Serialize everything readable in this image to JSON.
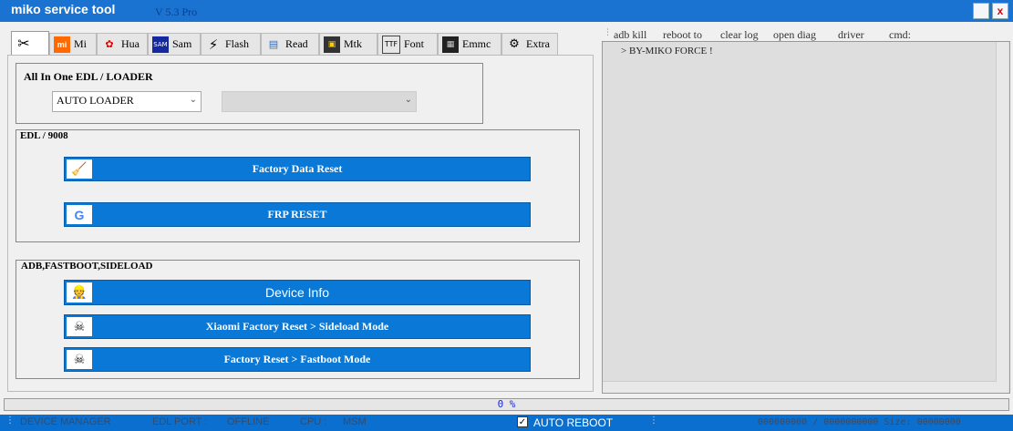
{
  "window": {
    "title": "miko service tool",
    "version": "V 5.3 Pro",
    "close_glyph": "x"
  },
  "tabs": [
    {
      "label": "",
      "icon": "tools-icon"
    },
    {
      "label": "Mi",
      "icon": "mi-logo-icon"
    },
    {
      "label": "Hua",
      "icon": "huawei-logo-icon"
    },
    {
      "label": "Sam",
      "icon": "samsung-logo-icon"
    },
    {
      "label": "Flash",
      "icon": "lightning-icon"
    },
    {
      "label": "Read",
      "icon": "database-icon"
    },
    {
      "label": "Mtk",
      "icon": "chip-icon"
    },
    {
      "label": "Font",
      "icon": "font-file-icon"
    },
    {
      "label": "Emmc",
      "icon": "emmc-chip-icon"
    },
    {
      "label": "Extra",
      "icon": "extra-icon"
    }
  ],
  "edl_loader": {
    "label": "All In One  EDL / LOADER",
    "loader_select": "AUTO LOADER",
    "second_select": ""
  },
  "edl_group": {
    "label": "EDL / 9008",
    "buttons": [
      {
        "label": "Factory Data Reset",
        "icon": "broom-icon"
      },
      {
        "label": "FRP RESET",
        "icon": "google-icon"
      }
    ]
  },
  "adb_group": {
    "label": "ADB,FASTBOOT,SIDELOAD",
    "buttons": [
      {
        "label": "Device Info",
        "icon": "technician-icon"
      },
      {
        "label": "Xiaomi Factory Reset > Sideload Mode",
        "icon": "skull-icon"
      },
      {
        "label": "Factory Reset > Fastboot Mode",
        "icon": "skull-icon"
      }
    ]
  },
  "right_menu": [
    "adb kill",
    "reboot to",
    "clear log",
    "open diag",
    "driver",
    "cmd:"
  ],
  "log": {
    "line1": "> BY-MIKO FORCE !"
  },
  "progress": {
    "text": "0  %",
    "value": 0
  },
  "status": {
    "device_manager": "DEVICE MANAGER",
    "edl_port": "EDL PORT :",
    "offline": "OFFLINE",
    "cpu": "CPU :",
    "msm": "MSM",
    "auto_reboot": "AUTO REBOOT",
    "auto_reboot_checked": true,
    "size_counter": "000000000 / 0000000000 Size: 00000000"
  },
  "colors": {
    "accent": "#0a78d6",
    "titlebar": "#1a73d1"
  }
}
